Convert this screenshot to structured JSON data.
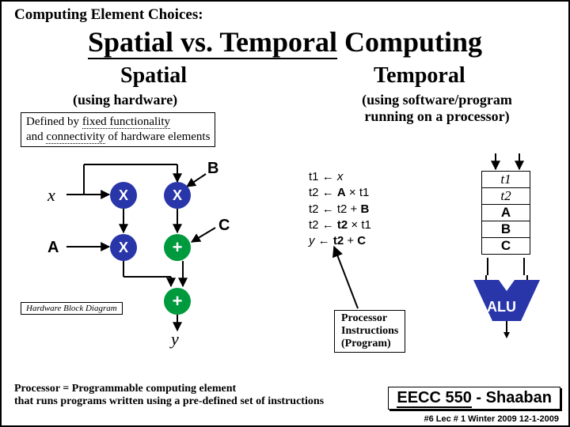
{
  "header": "Computing Element Choices:",
  "title_a": "Spatial vs. Temporal",
  "title_b": " Computing",
  "cols": {
    "left": "Spatial",
    "right": "Temporal"
  },
  "sub": {
    "left": "(using hardware)",
    "right": "(using software/program running on a processor)"
  },
  "defbox": {
    "pre": "Defined by ",
    "u1": "fixed functionality",
    "mid1": "\nand ",
    "u2": "connectivity",
    "post": " of hardware elements"
  },
  "sdiag": {
    "x": "x",
    "A": "A",
    "B": "B",
    "C": "C",
    "y": "y",
    "mult": "X",
    "add": "+",
    "hwlabel": "Hardware Block Diagram"
  },
  "instr": {
    "l1a": "t1",
    "l1b": "x",
    "l2a": "t2",
    "l2b": "A",
    "l2c": "t1",
    "l3a": "t2",
    "l3b": "t2",
    "l3c": "B",
    "l4a": "t2",
    "l4b": "t2",
    "l4c": "t1",
    "l5a": "y",
    "l5b": "t2",
    "l5c": "C",
    "arrow": "←",
    "times": "×",
    "plus": "+"
  },
  "regs": [
    "t1",
    "t2",
    "A",
    "B",
    "C"
  ],
  "alu": "ALU",
  "pibox": {
    "l1": "Processor",
    "l2": "Instructions",
    "l3": "(Program)"
  },
  "procnote": {
    "l1": "Processor =  Programmable computing element",
    "l2": "that runs programs written using a pre-defined set of instructions"
  },
  "course": {
    "a": "EECC 550",
    "b": " - Shaaban"
  },
  "foot": "#6   Lec # 1  Winter 2009  12-1-2009"
}
